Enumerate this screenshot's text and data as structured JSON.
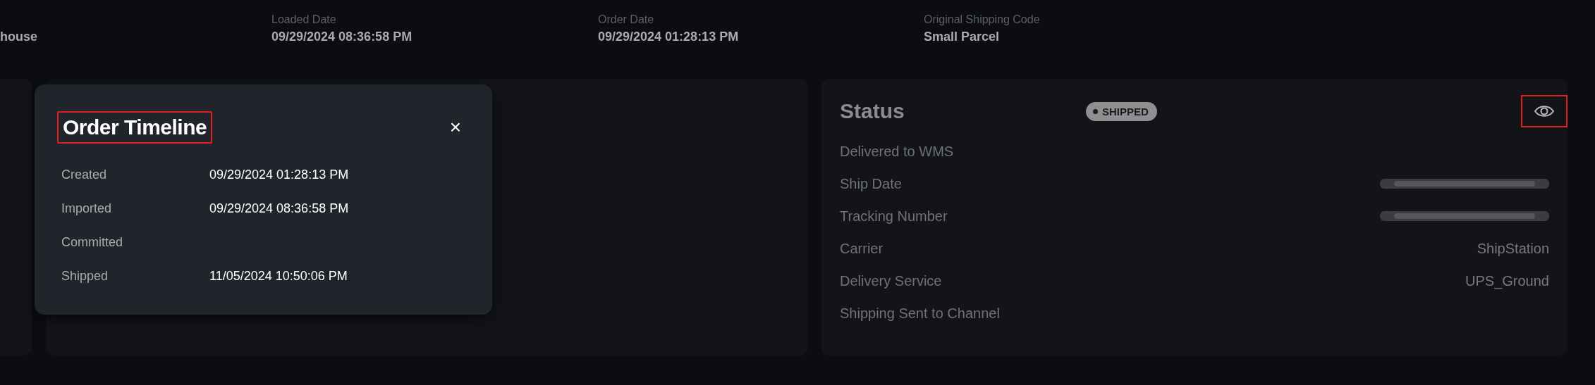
{
  "header_fields": [
    {
      "value": "house"
    },
    {
      "label": "Loaded Date",
      "value": "09/29/2024 08:36:58 PM"
    },
    {
      "label": "Order Date",
      "value": "09/29/2024 01:28:13 PM"
    },
    {
      "label": "Original Shipping Code",
      "value": "Small Parcel"
    }
  ],
  "timeline_modal": {
    "title": "Order Timeline",
    "title_highlighted": true,
    "close": "×",
    "rows": [
      {
        "label": "Created",
        "value": "09/29/2024 01:28:13 PM"
      },
      {
        "label": "Imported",
        "value": "09/29/2024 08:36:58 PM"
      },
      {
        "label": "Committed",
        "value": null
      },
      {
        "label": "Shipped",
        "value": "11/05/2024 10:50:06 PM"
      }
    ]
  },
  "status_panel": {
    "title": "Status",
    "badge": "SHIPPED",
    "view_button_highlighted": true,
    "rows": [
      {
        "label": "Delivered to WMS",
        "kind": "empty"
      },
      {
        "label": "Ship Date",
        "kind": "redacted"
      },
      {
        "label": "Tracking Number",
        "kind": "redacted"
      },
      {
        "label": "Carrier",
        "kind": "text",
        "value": "ShipStation"
      },
      {
        "label": "Delivery Service",
        "kind": "text",
        "value": "UPS_Ground"
      },
      {
        "label": "Shipping Sent to Channel",
        "kind": "empty"
      }
    ]
  }
}
